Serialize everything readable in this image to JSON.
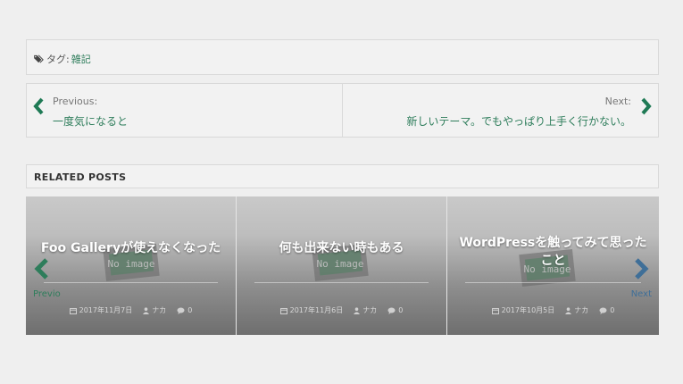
{
  "tags": {
    "label": "タグ:",
    "items": [
      "雑記"
    ]
  },
  "post_nav": {
    "previous_label": "Previous:",
    "previous_title": "一度気になると",
    "next_label": "Next:",
    "next_title": "新しいテーマ。でもやっぱり上手く行かない。"
  },
  "related": {
    "heading": "RELATED POSTS",
    "prev_label": "Previo",
    "next_label": "Next",
    "placeholder_text": "No image",
    "posts": [
      {
        "title": "Foo Galleryが使えなくなった",
        "date": "2017年11月7日",
        "author": "ナカ",
        "comments": "0"
      },
      {
        "title": "何も出来ない時もある",
        "date": "2017年11月6日",
        "author": "ナカ",
        "comments": "0"
      },
      {
        "title": "WordPressを触ってみて思ったこと",
        "date": "2017年10月5日",
        "author": "ナカ",
        "comments": "0"
      }
    ]
  },
  "colors": {
    "link_green": "#2e7d5b",
    "nav_arrow_green": "#1f7a55",
    "carousel_next_blue": "#3f6f98"
  },
  "icons": [
    "tag-icon",
    "chevron-left-icon",
    "chevron-right-icon",
    "calendar-icon",
    "user-icon",
    "comment-icon"
  ]
}
